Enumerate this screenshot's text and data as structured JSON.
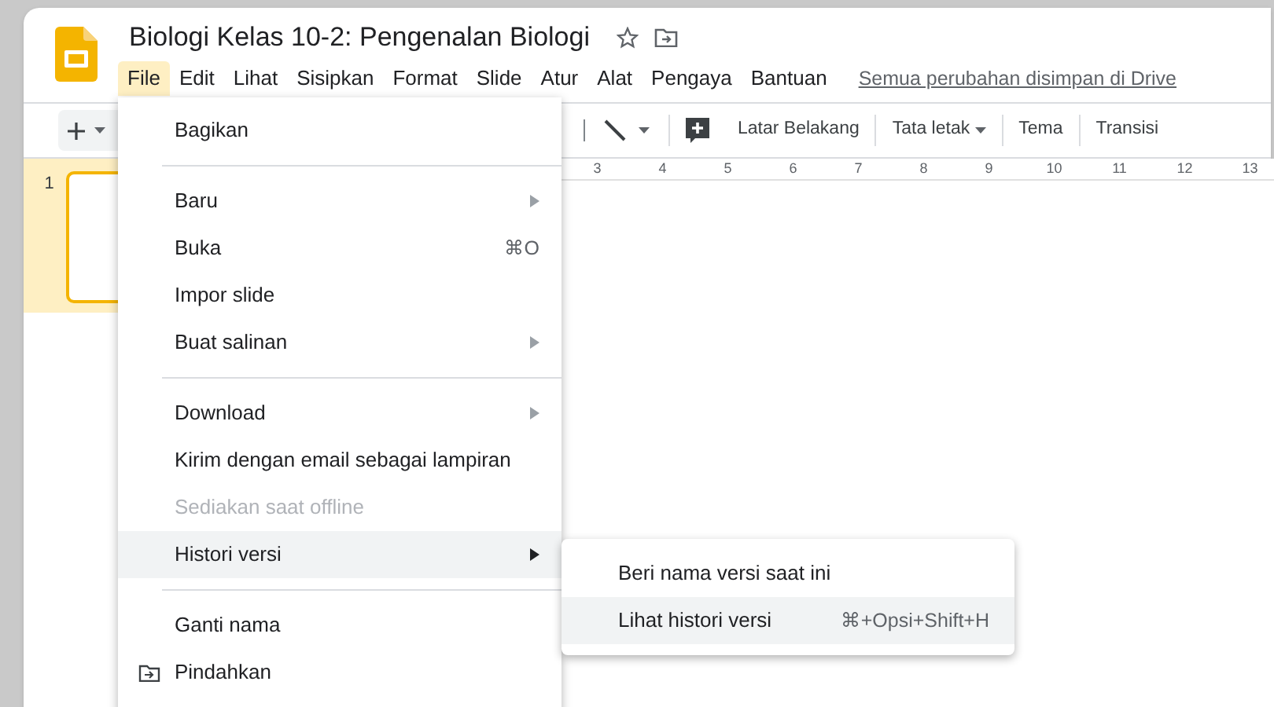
{
  "document": {
    "title": "Biologi Kelas 10-2: Pengenalan Biologi",
    "starred": false
  },
  "menu_bar": [
    {
      "label": "File",
      "selected": true
    },
    {
      "label": "Edit",
      "selected": false
    },
    {
      "label": "Lihat",
      "selected": false
    },
    {
      "label": "Sisipkan",
      "selected": false
    },
    {
      "label": "Format",
      "selected": false
    },
    {
      "label": "Slide",
      "selected": false
    },
    {
      "label": "Atur",
      "selected": false
    },
    {
      "label": "Alat",
      "selected": false
    },
    {
      "label": "Pengaya",
      "selected": false
    },
    {
      "label": "Bantuan",
      "selected": false
    }
  ],
  "save_status": "Semua perubahan disimpan di Drive",
  "toolbar": {
    "buttons": [
      {
        "label": "Latar Belakang",
        "dropdown": false
      },
      {
        "label": "Tata letak",
        "dropdown": true
      },
      {
        "label": "Tema",
        "dropdown": false
      },
      {
        "label": "Transisi",
        "dropdown": false
      }
    ]
  },
  "ruler": [
    "3",
    "4",
    "5",
    "6",
    "7",
    "8",
    "9",
    "10",
    "11",
    "12",
    "13"
  ],
  "slides": [
    {
      "number": "1",
      "selected": true
    }
  ],
  "file_menu": [
    {
      "kind": "item",
      "label": "Bagikan"
    },
    {
      "kind": "separator"
    },
    {
      "kind": "item",
      "label": "Baru",
      "submenu": true
    },
    {
      "kind": "item",
      "label": "Buka",
      "shortcut": "⌘O"
    },
    {
      "kind": "item",
      "label": "Impor slide"
    },
    {
      "kind": "item",
      "label": "Buat salinan",
      "submenu": true
    },
    {
      "kind": "separator"
    },
    {
      "kind": "item",
      "label": "Download",
      "submenu": true
    },
    {
      "kind": "item",
      "label": "Kirim dengan email sebagai lampiran"
    },
    {
      "kind": "item",
      "label": "Sediakan saat offline",
      "disabled": true
    },
    {
      "kind": "item",
      "label": "Histori versi",
      "submenu": true,
      "selected": true
    },
    {
      "kind": "separator"
    },
    {
      "kind": "item",
      "label": "Ganti nama"
    },
    {
      "kind": "folder_item",
      "label": "Pindahkan"
    }
  ],
  "version_submenu": [
    {
      "label": "Beri nama versi saat ini",
      "selected": false
    },
    {
      "label": "Lihat histori versi",
      "shortcut": "⌘+Opsi+Shift+H",
      "selected": true
    }
  ]
}
